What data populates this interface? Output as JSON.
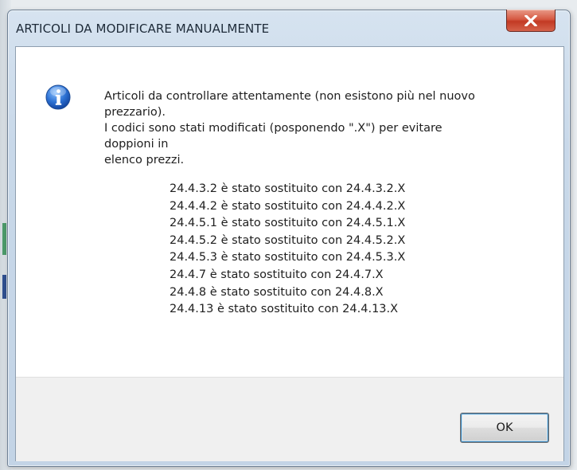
{
  "dialog": {
    "title": "ARTICOLI DA MODIFICARE MANUALMENTE",
    "icon": "information-icon",
    "message_lines": [
      "Articoli da controllare attentamente (non esistono più nel nuovo",
      "prezzario).",
      "I codici sono stati modificati (posponendo \".X\") per evitare",
      "doppioni in",
      "elenco prezzi."
    ],
    "replacements": [
      "24.4.3.2 è stato sostituito con  24.4.3.2.X",
      "24.4.4.2 è stato sostituito con  24.4.4.2.X",
      "24.4.5.1 è stato sostituito con  24.4.5.1.X",
      "24.4.5.2 è stato sostituito con  24.4.5.2.X",
      "24.4.5.3 è stato sostituito con  24.4.5.3.X",
      "24.4.7 è stato sostituito con  24.4.7.X",
      "24.4.8 è stato sostituito con  24.4.8.X",
      "24.4.13 è stato sostituito con  24.4.13.X"
    ],
    "ok_label": "OK",
    "close_icon": "close-icon"
  },
  "colors": {
    "title_bar": "#c8d8e9",
    "close_button": "#c94a32",
    "info_icon": "#2467c6",
    "button_bar": "#f0f0f0"
  }
}
